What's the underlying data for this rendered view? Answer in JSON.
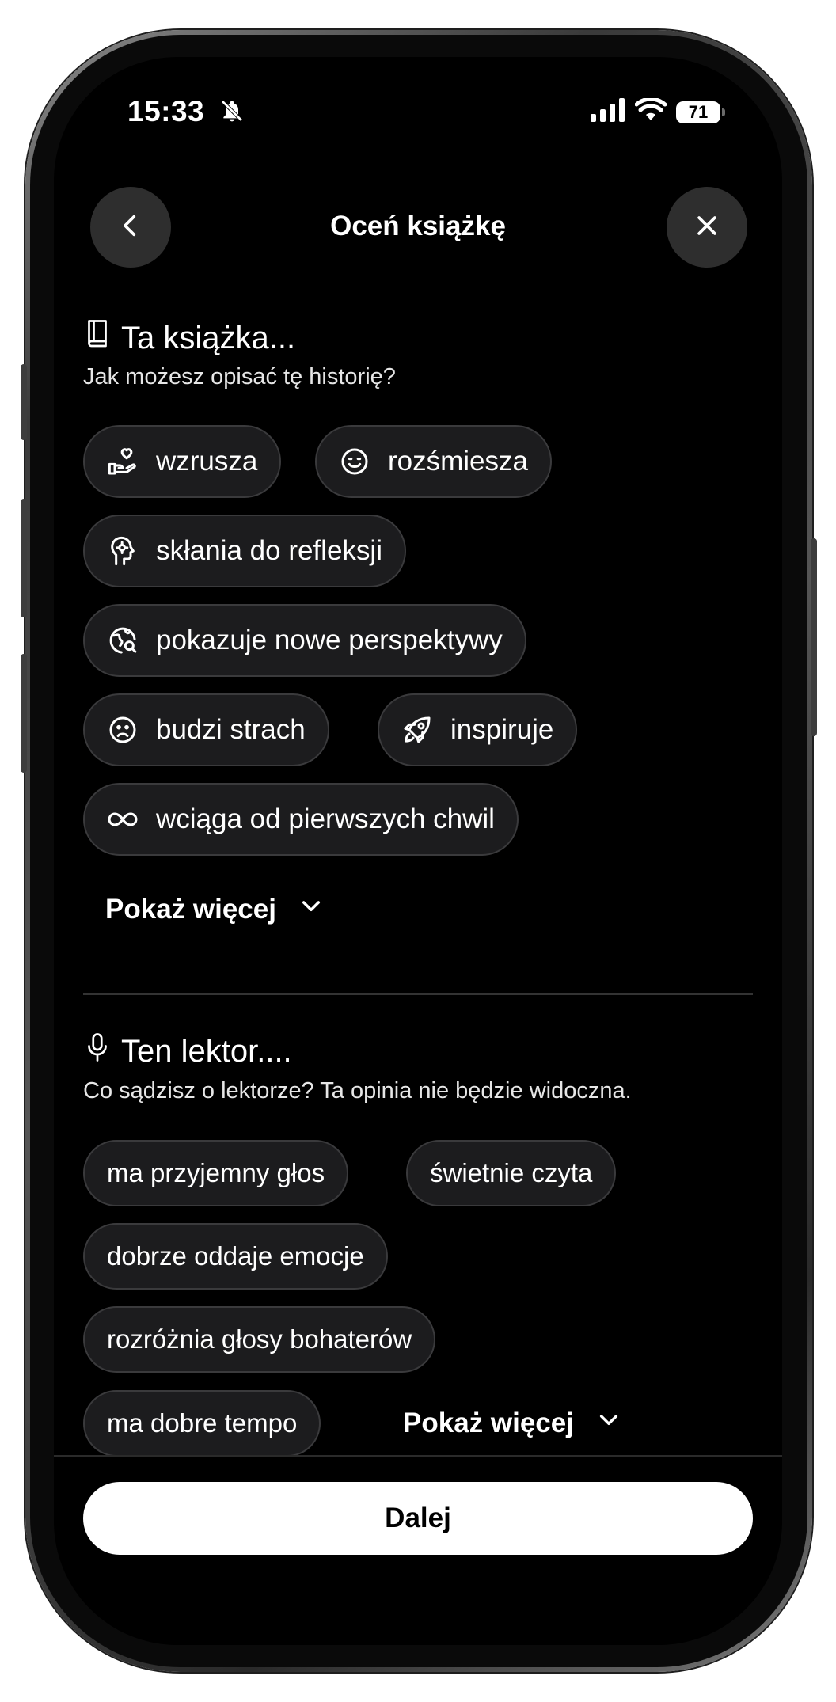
{
  "status_bar": {
    "time": "15:33",
    "battery": "71",
    "icons": [
      "bell-slash-icon",
      "signal-icon",
      "wifi-icon",
      "battery-icon"
    ]
  },
  "header": {
    "title": "Oceń książkę",
    "back_icon": "chevron-left-icon",
    "close_icon": "close-icon"
  },
  "book_section": {
    "icon": "book-icon",
    "title": "Ta książka...",
    "subtitle": "Jak możesz opisać tę historię?",
    "chips": [
      {
        "label": "wzrusza",
        "icon": "hand-heart-icon"
      },
      {
        "label": "rozśmiesza",
        "icon": "smile-icon"
      },
      {
        "label": "skłania do refleksji",
        "icon": "head-gear-icon"
      },
      {
        "label": "pokazuje nowe perspektywy",
        "icon": "globe-search-icon"
      },
      {
        "label": "budzi strach",
        "icon": "frown-icon"
      },
      {
        "label": "inspiruje",
        "icon": "rocket-icon"
      },
      {
        "label": "wciąga od pierwszych chwil",
        "icon": "infinity-icon"
      }
    ],
    "show_more": "Pokaż więcej"
  },
  "narrator_section": {
    "icon": "microphone-icon",
    "title": "Ten lektor....",
    "subtitle": "Co sądzisz o lektorze? Ta opinia nie będzie widoczna.",
    "chips": [
      {
        "label": "ma przyjemny głos"
      },
      {
        "label": "świetnie czyta"
      },
      {
        "label": "dobrze oddaje emocje"
      },
      {
        "label": "rozróżnia głosy bohaterów"
      },
      {
        "label": "ma dobre tempo"
      }
    ],
    "show_more": "Pokaż więcej"
  },
  "footer": {
    "next_label": "Dalej"
  },
  "colors": {
    "background": "#000000",
    "chip_background": "#1c1c1e",
    "chip_border": "#3a3a3c",
    "primary_button": "#ffffff"
  }
}
